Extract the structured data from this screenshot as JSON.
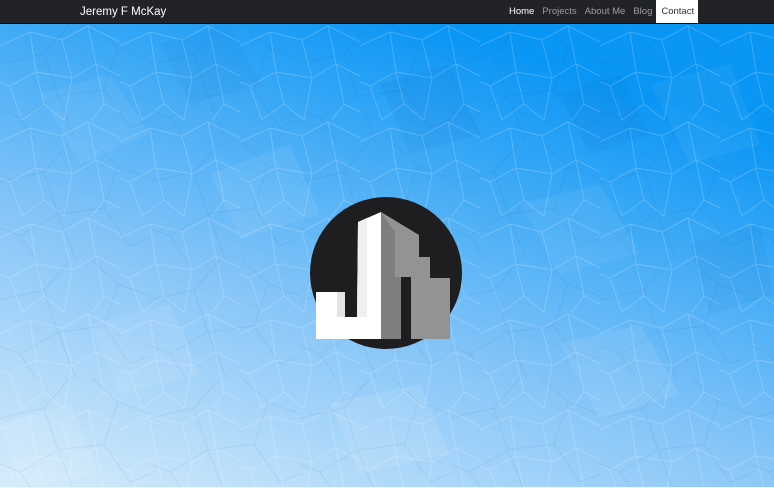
{
  "navbar": {
    "brand": "Jeremy F McKay",
    "links": [
      {
        "label": "Home",
        "state": "current"
      },
      {
        "label": "Projects",
        "state": "normal"
      },
      {
        "label": "About Me",
        "state": "normal"
      },
      {
        "label": "Blog",
        "state": "normal"
      },
      {
        "label": "Contact",
        "state": "active"
      }
    ]
  },
  "hero": {
    "logo_letters": "JM",
    "colors": {
      "sky_top": "#0a96f5",
      "sky_bottom": "#d6ecfb",
      "logo_circle": "#1e1e20",
      "letter_j": "#ffffff",
      "letter_m": "#939393"
    }
  }
}
